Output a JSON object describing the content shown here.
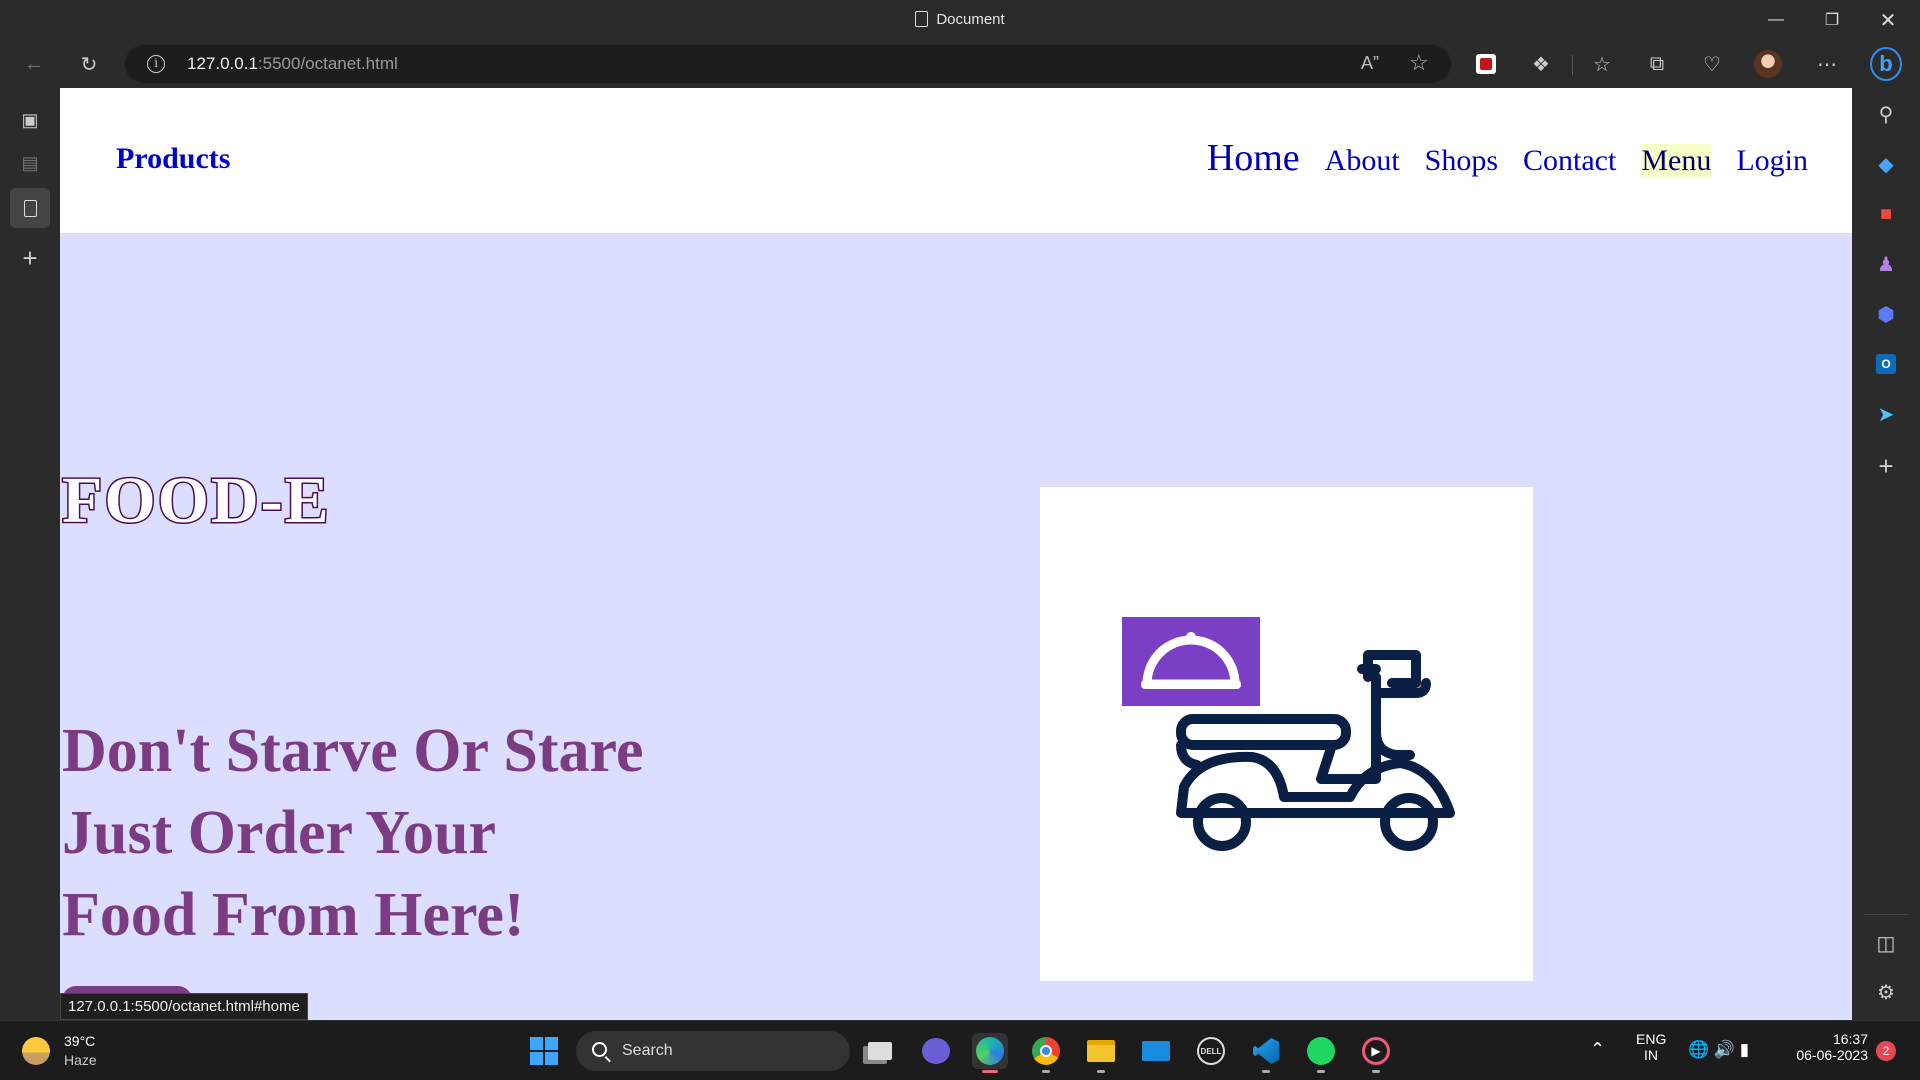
{
  "browser": {
    "window_title": "Document",
    "url_host": "127.0.0.1",
    "url_rest": ":5500/octanet.html",
    "status_link": "127.0.0.1:5500/octanet.html#home"
  },
  "site": {
    "brand": "Products",
    "nav": [
      {
        "label": "Home"
      },
      {
        "label": "About"
      },
      {
        "label": "Shops"
      },
      {
        "label": "Contact"
      },
      {
        "label": "Menu"
      },
      {
        "label": "Login"
      }
    ],
    "hero_title": "FOOD-E",
    "hero_tagline": [
      "Don't Starve Or Stare",
      "Just Order Your",
      "Food From Here!"
    ],
    "colors": {
      "page_bg": "#dcdefe",
      "nav_link": "#0000bb",
      "tagline": "#7b3c84",
      "title_outline": "#4b0b57",
      "cloche_box": "#7b3fc6",
      "scooter": "#0a1f44"
    }
  },
  "taskbar": {
    "weather_temp": "39°C",
    "weather_cond": "Haze",
    "search_label": "Search",
    "lang_top": "ENG",
    "lang_bottom": "IN",
    "time": "16:37",
    "date": "06-06-2023",
    "notifications": "2"
  }
}
